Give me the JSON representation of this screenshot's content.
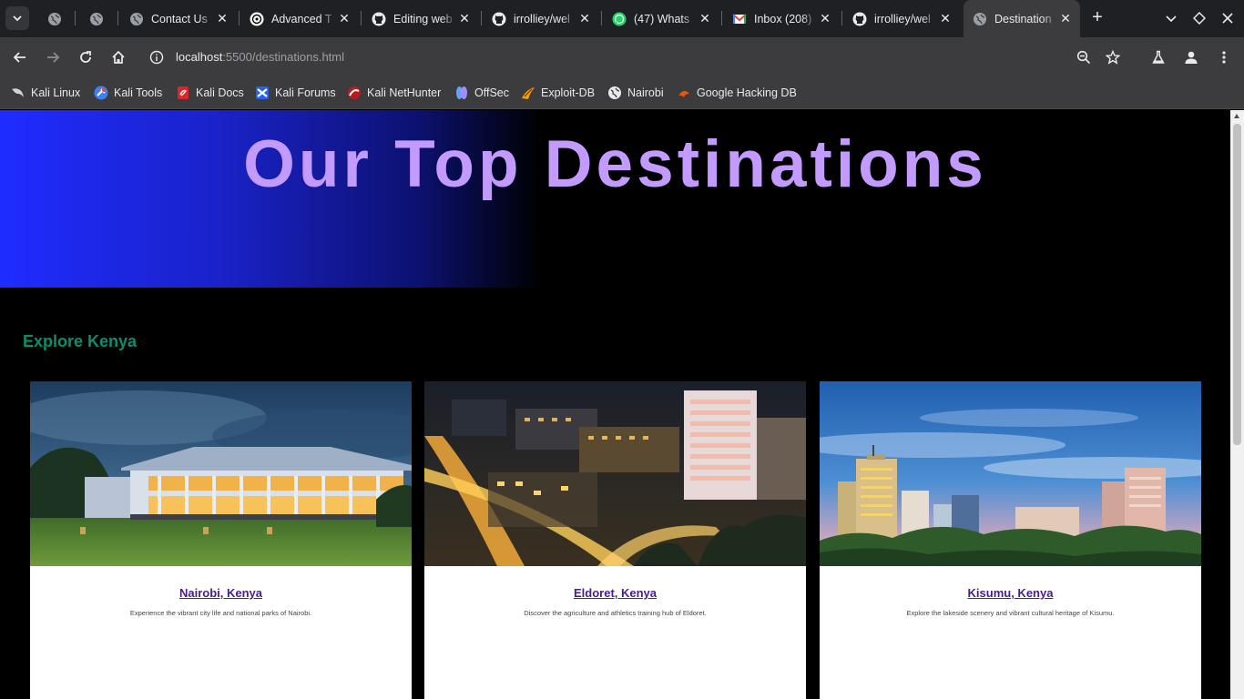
{
  "browser": {
    "tabs": [
      {
        "title": "",
        "icon": "globe-icon"
      },
      {
        "title": "",
        "icon": "globe-icon"
      },
      {
        "title": "Contact Us",
        "icon": "globe-icon"
      },
      {
        "title": "Advanced T",
        "icon": "openai-icon"
      },
      {
        "title": "Editing web",
        "icon": "github-icon"
      },
      {
        "title": "irrolliey/wel",
        "icon": "github-icon"
      },
      {
        "title": "(47) Whats",
        "icon": "whatsapp-icon"
      },
      {
        "title": "Inbox (208)",
        "icon": "gmail-icon"
      },
      {
        "title": "irrolliey/wel",
        "icon": "github-icon"
      },
      {
        "title": "Destination",
        "icon": "globe-icon",
        "active": true
      }
    ],
    "url_host": "localhost",
    "url_path": ":5500/destinations.html",
    "bookmarks": [
      {
        "label": "Kali Linux",
        "icon": "kali-dragon-icon"
      },
      {
        "label": "Kali Tools",
        "icon": "kali-tools-icon"
      },
      {
        "label": "Kali Docs",
        "icon": "kali-docs-icon"
      },
      {
        "label": "Kali Forums",
        "icon": "kali-forums-icon"
      },
      {
        "label": "Kali NetHunter",
        "icon": "nethunter-icon"
      },
      {
        "label": "OffSec",
        "icon": "offsec-icon"
      },
      {
        "label": "Exploit-DB",
        "icon": "exploit-db-icon"
      },
      {
        "label": "Nairobi",
        "icon": "globe-icon"
      },
      {
        "label": "Google Hacking DB",
        "icon": "ghdb-icon"
      }
    ]
  },
  "page": {
    "hero_title": "Our Top Destinations",
    "section_title": "Explore Kenya",
    "destinations": [
      {
        "name": "Nairobi, Kenya",
        "description": "Experience the vibrant city life and national parks of Nairobi."
      },
      {
        "name": "Eldoret, Kenya",
        "description": "Discover the agriculture and athletics training hub of Eldoret."
      },
      {
        "name": "Kisumu, Kenya",
        "description": "Explore the lakeside scenery and vibrant cultural heritage of Kisumu."
      }
    ]
  },
  "colors": {
    "hero_title": "#c39bff",
    "hero_gradient_start": "#1f2cff",
    "section_title": "#0e8d6e",
    "card_link": "#4a1c8c",
    "page_background": "#000000"
  }
}
